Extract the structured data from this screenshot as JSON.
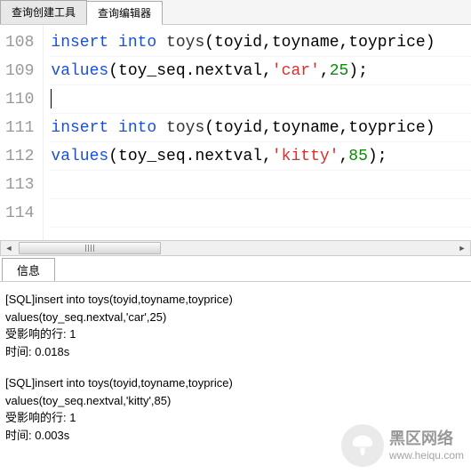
{
  "tabs_top": {
    "tab1": "查询创建工具",
    "tab2": "查询编辑器"
  },
  "editor": {
    "lines": {
      "108": {
        "no": "108",
        "kw": "insert into",
        "fn": "toys",
        "args": "(toyid,toyname,toyprice)"
      },
      "109": {
        "no": "109",
        "kw": "values",
        "open": "(",
        "seq": "toy_seq.nextval,",
        "str": "'car'",
        "comma": ",",
        "num": "25",
        "close": ");"
      },
      "110": {
        "no": "110"
      },
      "111": {
        "no": "111",
        "kw": "insert into",
        "fn": "toys",
        "args": "(toyid,toyname,toyprice)"
      },
      "112": {
        "no": "112",
        "kw": "values",
        "open": "(",
        "seq": "toy_seq.nextval,",
        "str": "'kitty'",
        "comma": ",",
        "num": "85",
        "close": ");"
      },
      "113": {
        "no": "113"
      },
      "114": {
        "no": "114"
      }
    }
  },
  "tabs_bottom": {
    "tab1": "信息"
  },
  "output": {
    "block1": {
      "l1": "[SQL]insert into toys(toyid,toyname,toyprice)",
      "l2": "values(toy_seq.nextval,'car',25)",
      "l3": "受影响的行: 1",
      "l4": "时间: 0.018s"
    },
    "block2": {
      "l1": "[SQL]insert into toys(toyid,toyname,toyprice)",
      "l2": "values(toy_seq.nextval,'kitty',85)",
      "l3": "受影响的行: 1",
      "l4": "时间: 0.003s"
    }
  },
  "watermark": {
    "title": "黑区网络",
    "url": "www.heiqu.com"
  }
}
